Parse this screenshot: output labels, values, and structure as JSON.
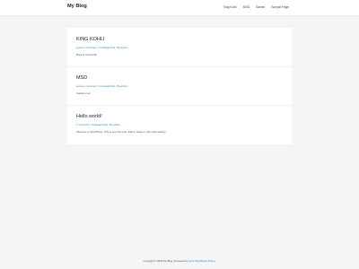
{
  "header": {
    "site_title": "My Blog",
    "nav": [
      "King Kohli",
      "MSD",
      "Sachin",
      "Sample Page"
    ]
  },
  "posts": [
    {
      "title": "KING KOHLI",
      "meta": {
        "comments": "Leave a Comment",
        "category": "Uncategorized",
        "author": "By admin"
      },
      "body": "Boss of Virat Kohli"
    },
    {
      "title": "MSD",
      "meta": {
        "comments": "Leave a Comment",
        "category": "Uncategorized",
        "author": "By admin"
      },
      "body": "Captain cool"
    },
    {
      "title": "Hello world!",
      "meta": {
        "comments": "1 Comment",
        "category": "Uncategorized",
        "author": "By admin"
      },
      "body": "Welcome to WordPress. This is your first post. Edit or delete it, then start writing!"
    }
  ],
  "footer": {
    "copyright": "Copyright © 2023 My Blog | Powered by ",
    "theme_link": "Astra WordPress Theme"
  },
  "colors": {
    "accent": "#2d88c8",
    "background": "#f5f5f5"
  }
}
